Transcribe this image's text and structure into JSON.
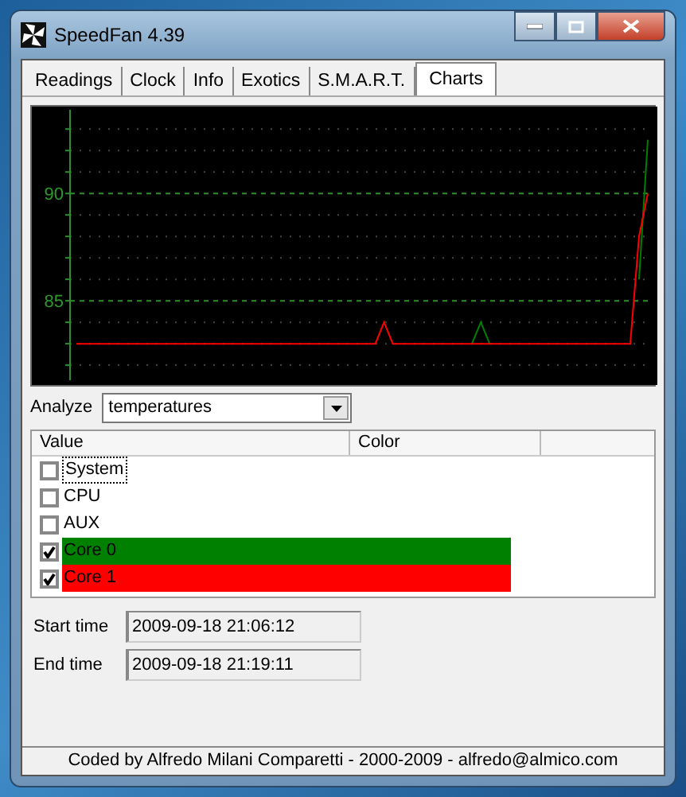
{
  "window": {
    "title": "SpeedFan 4.39"
  },
  "tabs": [
    {
      "label": "Readings",
      "selected": false
    },
    {
      "label": "Clock",
      "selected": false
    },
    {
      "label": "Info",
      "selected": false
    },
    {
      "label": "Exotics",
      "selected": false
    },
    {
      "label": "S.M.A.R.T.",
      "selected": false
    },
    {
      "label": "Charts",
      "selected": true
    }
  ],
  "chart": {
    "chart_data": {
      "type": "line",
      "ylim": [
        81.3,
        93.9
      ],
      "yticks": [
        85,
        90
      ],
      "series": [
        {
          "color": "#008000",
          "values": [
            null,
            null,
            null,
            null,
            null,
            null,
            null,
            null,
            null,
            null,
            null,
            null,
            null,
            null,
            null,
            null,
            null,
            null,
            null,
            null,
            null,
            null,
            null,
            null,
            null,
            null,
            null,
            null,
            null,
            null,
            null,
            null,
            null,
            null,
            null,
            null,
            null,
            null,
            null,
            null,
            null,
            null,
            null,
            null,
            null,
            83,
            84,
            83,
            null,
            null,
            null,
            null,
            null,
            null,
            null,
            null,
            null,
            null,
            null,
            null,
            null,
            null,
            null,
            null,
            86,
            92.5
          ]
        },
        {
          "color": "#ff0000",
          "values": [
            83,
            83,
            83,
            83,
            83,
            83,
            83,
            83,
            83,
            83,
            83,
            83,
            83,
            83,
            83,
            83,
            83,
            83,
            83,
            83,
            83,
            83,
            83,
            83,
            83,
            83,
            83,
            83,
            83,
            83,
            83,
            83,
            83,
            83,
            83,
            84,
            83,
            83,
            83,
            83,
            83,
            83,
            83,
            83,
            83,
            83,
            83,
            83,
            83,
            83,
            83,
            83,
            83,
            83,
            83,
            83,
            83,
            83,
            83,
            83,
            83,
            83,
            83,
            83,
            88,
            90
          ]
        }
      ]
    }
  },
  "analyze": {
    "label": "Analyze",
    "value": "temperatures"
  },
  "list": {
    "columns": [
      "Value",
      "Color"
    ],
    "rows": [
      {
        "label": "System",
        "checked": false,
        "focused": true
      },
      {
        "label": "CPU",
        "checked": false,
        "focused": false
      },
      {
        "label": "AUX",
        "checked": false,
        "focused": false
      },
      {
        "label": "Core 0",
        "checked": true,
        "focused": false,
        "color": "#008000"
      },
      {
        "label": "Core 1",
        "checked": true,
        "focused": false,
        "color": "#ff0000"
      }
    ]
  },
  "times": [
    {
      "label": "Start time",
      "value": "2009-09-18 21:06:12"
    },
    {
      "label": "End time",
      "value": "2009-09-18 21:19:11"
    }
  ],
  "status_bar": "Coded by Alfredo Milani Comparetti - 2000-2009 - alfredo@almico.com"
}
